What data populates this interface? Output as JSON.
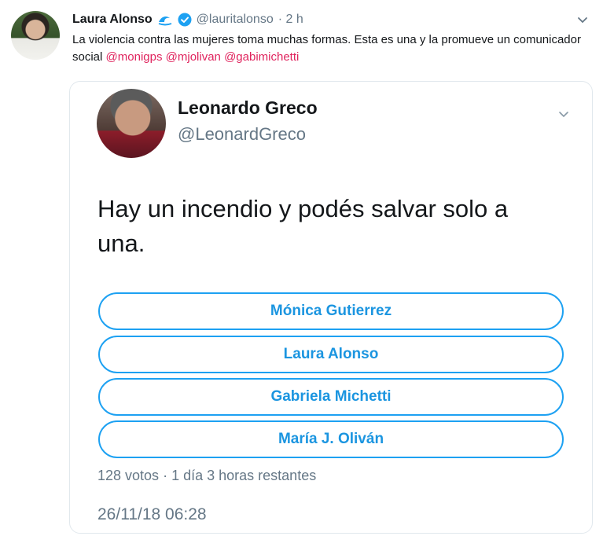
{
  "tweet": {
    "author_name": "Laura Alonso",
    "author_handle": "@lauritalonso",
    "time": "· 2 h",
    "text": "La violencia contra las mujeres toma muchas formas. Esta es una y la promueve un comunicador social",
    "mentions": [
      "@monigps",
      "@mjolivan",
      "@gabimichetti"
    ],
    "colors": {
      "mention": "#e0245e",
      "verified": "#1da1f2"
    }
  },
  "quoted": {
    "author_name": "Leonardo Greco",
    "author_handle": "@LeonardGreco",
    "text": "Hay un incendio y podés salvar solo a una.",
    "poll": {
      "options": [
        "Mónica Gutierrez",
        "Laura Alonso",
        "Gabriela Michetti",
        "María J. Oliván"
      ],
      "votes": "128 votos",
      "remaining": "1 día 3 horas restantes"
    },
    "timestamp": "26/11/18 06:28",
    "colors": {
      "poll_border": "#1da1f2",
      "poll_text": "#1b95e0"
    }
  },
  "icons": [
    "wave-emoji-icon",
    "verified-badge-icon",
    "chevron-down-icon"
  ]
}
